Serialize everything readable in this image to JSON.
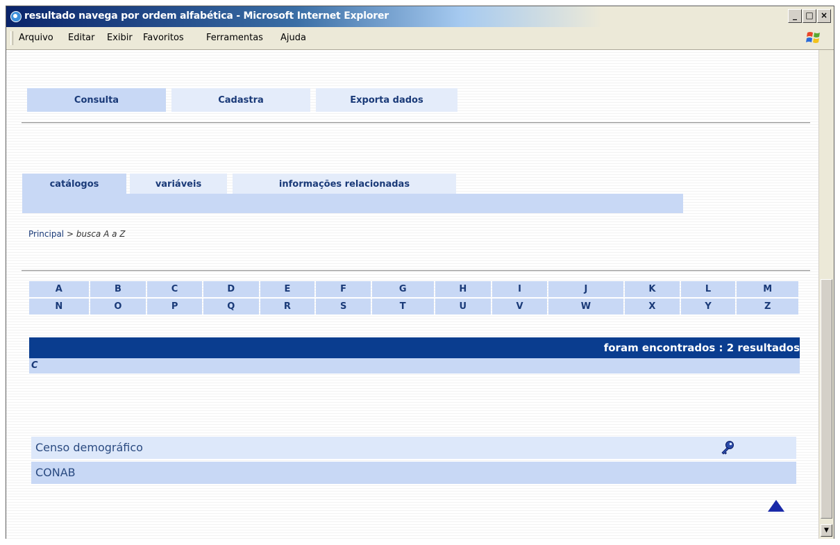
{
  "window": {
    "title": "resultado navega por ordem alfabética - Microsoft Internet Explorer",
    "buttons": {
      "minimize": "_",
      "maximize": "□",
      "close": "×"
    }
  },
  "menu": [
    "Arquivo",
    "Editar",
    "Exibir",
    "Favoritos",
    "Ferramentas",
    "Ajuda"
  ],
  "top_tabs": [
    "Consulta",
    "Cadastra",
    "Exporta dados"
  ],
  "sub_tabs": [
    "catálogos",
    "variáveis",
    "informações relacionadas"
  ],
  "breadcrumb": {
    "home": "Principal",
    "separator": ">",
    "current": "busca A a Z"
  },
  "alphabet": {
    "row1": [
      "A",
      "B",
      "C",
      "D",
      "E",
      "F",
      "G",
      "H",
      "I",
      "J",
      "K",
      "L",
      "M"
    ],
    "row2": [
      "N",
      "O",
      "P",
      "Q",
      "R",
      "S",
      "T",
      "U",
      "V",
      "W",
      "X",
      "Y",
      "Z"
    ]
  },
  "results": {
    "summary": "foram encontrados : 2 resultados",
    "group_letter": "C",
    "items": [
      "Censo demográfico",
      "CONAB"
    ]
  },
  "scrollbar": {
    "down_arrow": "▼"
  },
  "icons": {
    "key": "key-icon",
    "back_to_top": "arrow-up-icon",
    "page": "ie-page-icon",
    "logo": "windows-logo-icon"
  },
  "colors": {
    "results_bar": "#0a3d8f",
    "tab_active": "#c8d8f5",
    "tab_inactive": "#e4ecfa",
    "link_text": "#1a3a78",
    "top_arrow": "#1a2aa8"
  }
}
